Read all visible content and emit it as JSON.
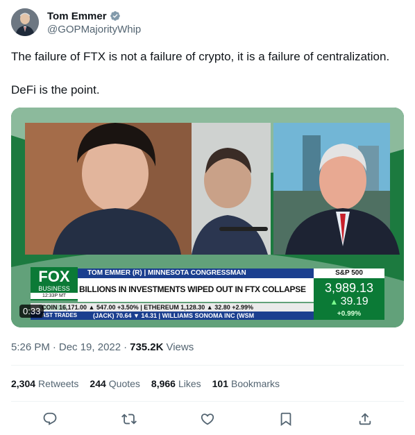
{
  "author": {
    "display_name": "Tom Emmer",
    "handle": "@GOPMajorityWhip",
    "verified_color": "#829aab"
  },
  "tweet": {
    "paragraphs": [
      "The failure of FTX is not a failure of crypto, it is a failure of centralization.",
      "DeFi is the point."
    ]
  },
  "media": {
    "duration": "0:33",
    "chyron": {
      "logo_top": "FOX",
      "logo_bottom": "BUSINESS",
      "time": "12:33P MT",
      "name_line": "TOM EMMER (R) | MINNESOTA CONGRESSMAN",
      "headline": "BILLIONS IN INVESTMENTS WIPED OUT IN FTX COLLAPSE",
      "index_label": "S&P 500",
      "index_value": "3,989.13",
      "index_change": "39.19",
      "index_percent": "+0.99%",
      "ticker_1": "COIN   16,171.00 ▲ 547.00 +3.50% | ETHEREUM   1,128.30 ▲ 32.80 +2.99%",
      "ticker_2_label": "AST TRADES",
      "ticker_2": "(JACK)  70.64  ▼ 14.31  |  WILLIAMS SONOMA INC (WSM"
    }
  },
  "meta": {
    "time": "5:26 PM",
    "separator": "·",
    "date": "Dec 19, 2022",
    "views_count": "735.2K",
    "views_label": "Views"
  },
  "stats": {
    "retweets_count": "2,304",
    "retweets_label": "Retweets",
    "quotes_count": "244",
    "quotes_label": "Quotes",
    "likes_count": "8,966",
    "likes_label": "Likes",
    "bookmarks_count": "101",
    "bookmarks_label": "Bookmarks"
  },
  "actions": [
    "reply-icon",
    "retweet-icon",
    "like-icon",
    "bookmark-icon",
    "share-icon"
  ],
  "colors": {
    "icon": "#536471",
    "fox_blue": "#1b3f8f",
    "fox_green": "#0b7a36"
  }
}
